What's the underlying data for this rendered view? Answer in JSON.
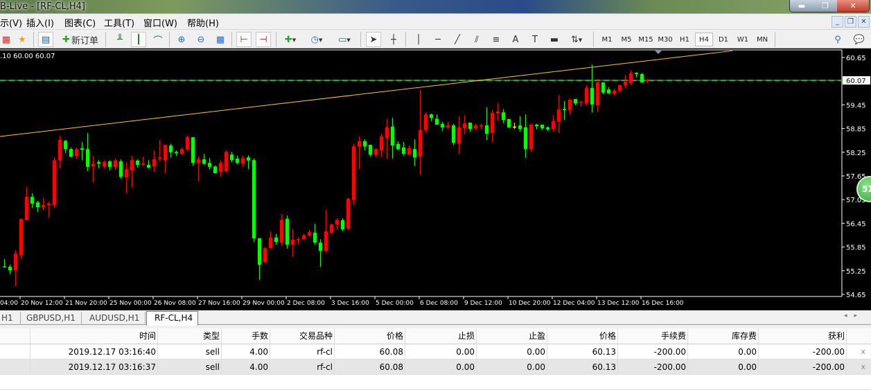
{
  "window": {
    "title": "B-Live - [RF-CL,H4]",
    "controls": [
      "minimize",
      "maximize",
      "close"
    ]
  },
  "menu": {
    "items": [
      "示(V)",
      "插入(I)",
      "图表(C)",
      "工具(T)",
      "窗口(W)",
      "帮助(H)"
    ]
  },
  "toolbar": {
    "new_order_label": "新订单",
    "icons": [
      "profiles-icon",
      "favorites-icon",
      "navigator-icon",
      "new-order-icon",
      "bar-chart-icon",
      "candlestick-icon",
      "line-chart-icon",
      "zoom-in-icon",
      "zoom-out-icon",
      "tile-windows-icon",
      "chart-shift-icon",
      "autoscroll-icon",
      "indicators-icon",
      "periods-icon",
      "templates-icon",
      "cursor-icon",
      "crosshair-icon",
      "vertical-line-icon",
      "horizontal-line-icon",
      "trendline-icon",
      "fibonacci-icon",
      "fibo-fan-icon",
      "text-icon",
      "text-label-icon",
      "rectangle-icon",
      "arrows-icon"
    ],
    "timeframes": [
      "M1",
      "M5",
      "M15",
      "M30",
      "H1",
      "H4",
      "D1",
      "W1",
      "MN"
    ],
    "active_timeframe": "H4"
  },
  "chart_data": {
    "type": "candlestick",
    "symbol": "RF-CL",
    "timeframe": "H4",
    "ohlc_readout": ".10 60.00 60.07",
    "bid": "60.07",
    "price_ticks": [
      "60.65",
      "59.45",
      "58.85",
      "58.25",
      "57.65",
      "57.05",
      "56.45",
      "55.85",
      "55.25",
      "54.65"
    ],
    "time_ticks": [
      "04:00",
      "20 Nov 12:00",
      "21 Nov 20:00",
      "25 Nov 00:00",
      "26 Nov 08:00",
      "27 Nov 16:00",
      "29 Nov 00:00",
      "2 Dec 08:00",
      "3 Dec 16:00",
      "5 Dec 00:00",
      "6 Dec 08:00",
      "9 Dec 12:00",
      "10 Dec 20:00",
      "12 Dec 04:00",
      "13 Dec 12:00",
      "16 Dec 16:00"
    ],
    "ylim": [
      54.55,
      60.75
    ],
    "trendline": {
      "from_price": 58.65,
      "to_price": 60.82
    },
    "colors": {
      "bull": "#ff0000",
      "bear": "#00ff00",
      "doji": "#ffff00",
      "trendline": "#ffcc00",
      "bid_line": "#00c000",
      "background": "#000000"
    },
    "candles": [
      [
        55.36,
        55.55,
        55.33,
        55.35
      ],
      [
        55.35,
        55.4,
        55.16,
        55.26
      ],
      [
        55.26,
        55.77,
        54.86,
        55.68
      ],
      [
        55.64,
        56.56,
        55.54,
        56.56
      ],
      [
        56.53,
        57.37,
        56.53,
        57.12
      ],
      [
        57.12,
        57.21,
        56.84,
        56.95
      ],
      [
        56.98,
        57.02,
        56.74,
        56.86
      ],
      [
        56.86,
        57.09,
        56.79,
        56.91
      ],
      [
        56.91,
        57.0,
        56.6,
        56.95
      ],
      [
        56.91,
        58.12,
        56.84,
        58.05
      ],
      [
        58.04,
        58.67,
        57.84,
        58.56
      ],
      [
        58.54,
        58.56,
        58.23,
        58.33
      ],
      [
        58.33,
        58.37,
        58.12,
        58.14
      ],
      [
        58.16,
        58.37,
        58.09,
        58.33
      ],
      [
        58.35,
        58.51,
        58.05,
        58.31
      ],
      [
        58.33,
        58.74,
        57.77,
        57.88
      ],
      [
        57.89,
        58.16,
        57.49,
        57.96
      ],
      [
        58.0,
        58.05,
        57.84,
        57.96
      ],
      [
        57.89,
        58.05,
        57.84,
        58.0
      ],
      [
        58.02,
        58.05,
        57.79,
        57.88
      ],
      [
        57.88,
        58.09,
        57.81,
        58.04
      ],
      [
        58.02,
        58.07,
        57.58,
        57.63
      ],
      [
        57.61,
        58.0,
        57.21,
        57.82
      ],
      [
        57.79,
        58.16,
        57.35,
        58.05
      ],
      [
        58.04,
        58.07,
        57.86,
        57.93
      ],
      [
        57.93,
        58.14,
        57.91,
        57.96
      ],
      [
        57.93,
        58.05,
        57.84,
        57.86
      ],
      [
        57.89,
        58.3,
        57.75,
        58.07
      ],
      [
        58.09,
        58.56,
        58.02,
        58.12
      ],
      [
        58.05,
        58.44,
        57.72,
        58.44
      ],
      [
        58.42,
        58.47,
        58.12,
        58.25
      ],
      [
        58.26,
        58.3,
        58.16,
        58.23
      ],
      [
        58.21,
        58.37,
        58.19,
        58.33
      ],
      [
        58.32,
        58.67,
        58.28,
        58.63
      ],
      [
        58.63,
        58.63,
        57.91,
        57.98
      ],
      [
        57.98,
        58.14,
        57.51,
        58.07
      ],
      [
        58.07,
        58.21,
        57.93,
        57.96
      ],
      [
        57.98,
        58.1,
        57.82,
        57.88
      ],
      [
        57.89,
        57.91,
        57.72,
        57.72
      ],
      [
        57.75,
        58.05,
        57.63,
        57.98
      ],
      [
        57.77,
        58.3,
        57.74,
        58.26
      ],
      [
        58.19,
        58.26,
        58.0,
        58.05
      ],
      [
        58.09,
        58.16,
        57.95,
        57.98
      ],
      [
        57.96,
        58.16,
        57.88,
        58.1
      ],
      [
        58.12,
        58.17,
        57.82,
        58.04
      ],
      [
        58.05,
        58.1,
        55.98,
        56.07
      ],
      [
        56.07,
        56.07,
        55.02,
        55.4
      ],
      [
        55.47,
        55.84,
        55.44,
        55.82
      ],
      [
        55.82,
        56.25,
        55.82,
        56.09
      ],
      [
        56.09,
        56.18,
        55.91,
        55.98
      ],
      [
        55.96,
        56.68,
        55.88,
        56.54
      ],
      [
        56.56,
        56.65,
        55.81,
        55.91
      ],
      [
        55.91,
        56.3,
        55.61,
        56.04
      ],
      [
        56.04,
        56.09,
        55.91,
        56.05
      ],
      [
        56.05,
        56.19,
        56.04,
        56.14
      ],
      [
        56.14,
        56.28,
        56.12,
        56.23
      ],
      [
        56.21,
        56.44,
        55.91,
        55.96
      ],
      [
        55.96,
        56.05,
        55.35,
        55.75
      ],
      [
        55.75,
        56.79,
        55.72,
        56.25
      ],
      [
        56.21,
        56.44,
        56.18,
        56.42
      ],
      [
        56.42,
        56.58,
        56.3,
        56.53
      ],
      [
        56.53,
        56.58,
        56.25,
        56.3
      ],
      [
        56.32,
        57.09,
        56.28,
        57.07
      ],
      [
        57.04,
        58.47,
        56.91,
        58.4
      ],
      [
        58.39,
        58.65,
        57.82,
        58.53
      ],
      [
        58.53,
        58.58,
        58.3,
        58.4
      ],
      [
        58.44,
        58.44,
        58.14,
        58.19
      ],
      [
        58.18,
        58.35,
        58.12,
        58.33
      ],
      [
        58.3,
        58.72,
        58.12,
        58.65
      ],
      [
        58.61,
        59.1,
        58.09,
        58.88
      ],
      [
        58.9,
        59.12,
        58.09,
        58.42
      ],
      [
        58.46,
        58.53,
        58.3,
        58.33
      ],
      [
        58.37,
        58.51,
        58.16,
        58.21
      ],
      [
        58.19,
        58.42,
        58.19,
        58.35
      ],
      [
        58.33,
        58.58,
        57.9,
        58.12
      ],
      [
        58.14,
        59.83,
        57.68,
        58.81
      ],
      [
        58.81,
        59.26,
        58.74,
        59.21
      ],
      [
        59.21,
        59.23,
        59.04,
        59.12
      ],
      [
        59.1,
        59.21,
        58.95,
        58.95
      ],
      [
        58.97,
        59.02,
        58.79,
        58.88
      ],
      [
        58.88,
        59.02,
        58.83,
        58.93
      ],
      [
        58.93,
        58.97,
        58.44,
        58.49
      ],
      [
        58.47,
        59.16,
        58.21,
        58.88
      ],
      [
        58.86,
        59.18,
        58.72,
        58.98
      ],
      [
        59.0,
        59.0,
        58.77,
        58.84
      ],
      [
        58.86,
        58.97,
        58.81,
        58.93
      ],
      [
        58.91,
        58.97,
        58.83,
        58.93
      ],
      [
        58.93,
        59.39,
        58.56,
        58.72
      ],
      [
        58.74,
        59.32,
        58.51,
        59.25
      ],
      [
        59.23,
        59.5,
        59.04,
        59.28
      ],
      [
        59.26,
        59.34,
        58.99,
        59.07
      ],
      [
        59.09,
        59.1,
        58.86,
        58.88
      ],
      [
        58.9,
        59.0,
        58.84,
        58.9
      ],
      [
        58.93,
        59.16,
        58.77,
        58.84
      ],
      [
        58.88,
        59.21,
        58.11,
        58.33
      ],
      [
        58.33,
        58.97,
        58.26,
        58.95
      ],
      [
        58.95,
        58.97,
        58.83,
        58.91
      ],
      [
        58.95,
        58.95,
        58.81,
        58.86
      ],
      [
        58.88,
        58.91,
        58.79,
        58.83
      ],
      [
        58.84,
        59.18,
        58.77,
        59.04
      ],
      [
        59.02,
        59.7,
        58.74,
        59.33
      ],
      [
        59.35,
        59.55,
        59.07,
        59.32
      ],
      [
        59.32,
        59.6,
        59.21,
        59.58
      ],
      [
        59.6,
        59.6,
        59.44,
        59.49
      ],
      [
        59.51,
        59.55,
        59.42,
        59.53
      ],
      [
        59.49,
        59.95,
        59.44,
        59.88
      ],
      [
        59.88,
        60.47,
        59.26,
        59.46
      ],
      [
        59.44,
        60.11,
        59.28,
        60.02
      ],
      [
        60.02,
        60.02,
        59.72,
        59.76
      ],
      [
        59.84,
        59.9,
        59.74,
        59.74
      ],
      [
        59.74,
        59.86,
        59.69,
        59.81
      ],
      [
        59.81,
        59.96,
        59.77,
        59.95
      ],
      [
        59.95,
        60.2,
        59.86,
        60.04
      ],
      [
        60.0,
        60.33,
        59.95,
        60.25
      ],
      [
        60.26,
        60.28,
        60.14,
        60.23
      ],
      [
        60.23,
        60.26,
        60.02,
        60.02
      ],
      [
        60.06,
        60.11,
        60.0,
        60.07
      ]
    ]
  },
  "floating_badge": "51",
  "chart_tabs": {
    "items": [
      "H1",
      "GBPUSD,H1",
      "AUDUSD,H1",
      "RF-CL,H4"
    ],
    "active": "RF-CL,H4"
  },
  "trade_table": {
    "headers": [
      "时间",
      "类型",
      "手数",
      "交易品种",
      "价格",
      "止损",
      "止盈",
      "价格",
      "手续费",
      "库存费",
      "获利"
    ],
    "rows": [
      [
        "2019.12.17 03:16:40",
        "sell",
        "4.00",
        "rf-cl",
        "60.08",
        "0.00",
        "0.00",
        "60.13",
        "-200.00",
        "0.00",
        "-200.00"
      ],
      [
        "2019.12.17 03:16:37",
        "sell",
        "4.00",
        "rf-cl",
        "60.08",
        "0.00",
        "0.00",
        "60.13",
        "-200.00",
        "0.00",
        "-200.00"
      ]
    ],
    "close_glyph": "x"
  }
}
